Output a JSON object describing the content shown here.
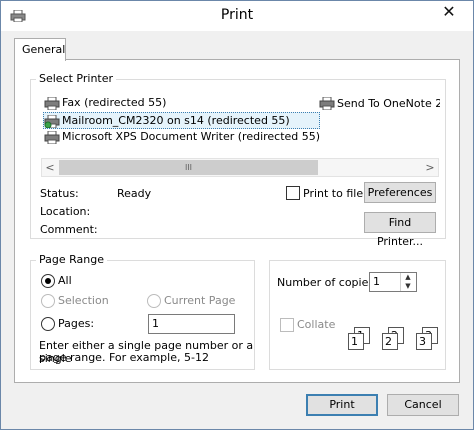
{
  "window": {
    "title": "Print",
    "close_icon": "✕"
  },
  "tabs": [
    {
      "label": "General"
    }
  ],
  "select_printer": {
    "legend": "Select Printer",
    "printers": [
      {
        "name": "Fax (redirected 55)"
      },
      {
        "name": "Send To OneNote 2"
      },
      {
        "name": "Mailroom_CM2320 on s14 (redirected 55)",
        "selected": true
      },
      {
        "name": "Microsoft XPS Document Writer (redirected 55)"
      }
    ],
    "scroll_left": "<",
    "scroll_right": ">",
    "scroll_thumb": "III"
  },
  "status": {
    "status_label": "Status:",
    "status_value": "Ready",
    "location_label": "Location:",
    "comment_label": "Comment:"
  },
  "print_to_file": {
    "label": "Print to file",
    "checked": false
  },
  "buttons": {
    "preferences": "Preferences",
    "find_printer": "Find Printer...",
    "print": "Print",
    "cancel": "Cancel"
  },
  "page_range": {
    "legend": "Page Range",
    "all_label": "All",
    "selection_label": "Selection",
    "current_page_label": "Current Page",
    "pages_label": "Pages:",
    "pages_value": "1",
    "help_line1": "Enter either a single page number or a single",
    "help_line2": "page range.  For example, 5-12"
  },
  "copies": {
    "label": "Number of copies:",
    "value": "1",
    "collate_label": "Collate",
    "collate_checked": false,
    "collate_pages": [
      "1",
      "1",
      "2",
      "2",
      "3",
      "3"
    ]
  },
  "colors": {
    "selected_bg": "#e5f3fb",
    "focus_border": "#3c7fb1"
  }
}
